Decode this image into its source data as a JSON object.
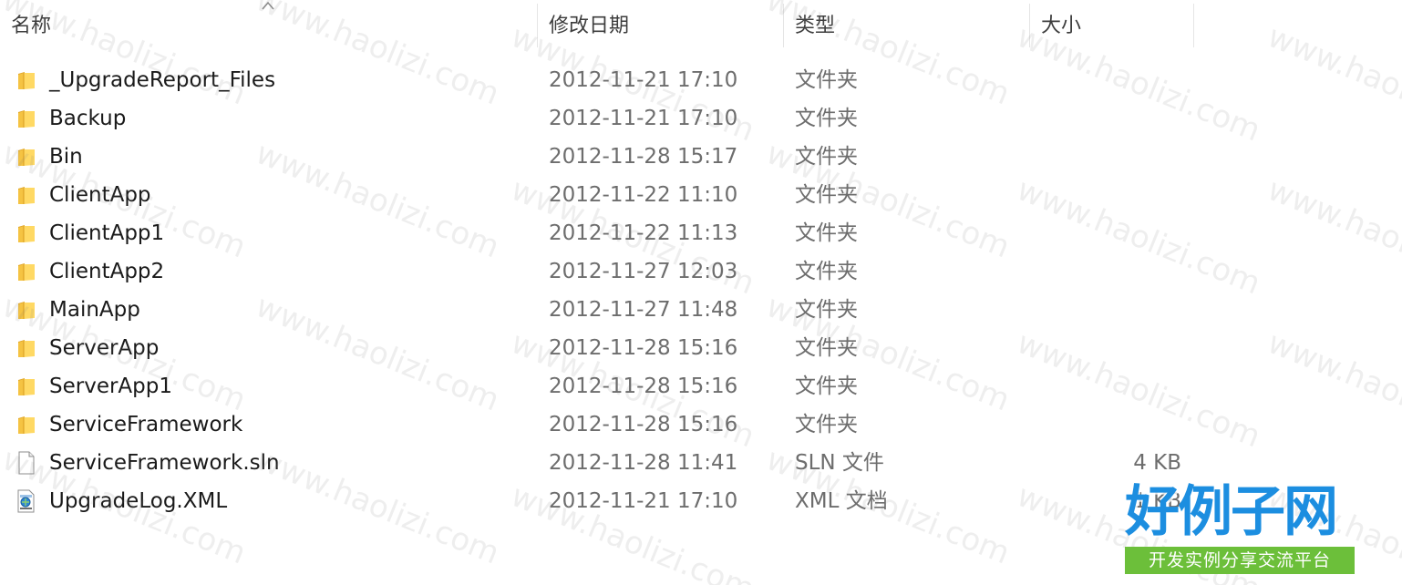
{
  "columns": {
    "name": "名称",
    "date": "修改日期",
    "type": "类型",
    "size": "大小"
  },
  "sort": {
    "column": "name",
    "direction": "ascending"
  },
  "files": [
    {
      "name": "_UpgradeReport_Files",
      "date": "2012-11-21 17:10",
      "type": "文件夹",
      "size": "",
      "icon": "folder-icon"
    },
    {
      "name": "Backup",
      "date": "2012-11-21 17:10",
      "type": "文件夹",
      "size": "",
      "icon": "folder-icon"
    },
    {
      "name": "Bin",
      "date": "2012-11-28 15:17",
      "type": "文件夹",
      "size": "",
      "icon": "folder-icon"
    },
    {
      "name": "ClientApp",
      "date": "2012-11-22 11:10",
      "type": "文件夹",
      "size": "",
      "icon": "folder-icon"
    },
    {
      "name": "ClientApp1",
      "date": "2012-11-22 11:13",
      "type": "文件夹",
      "size": "",
      "icon": "folder-icon"
    },
    {
      "name": "ClientApp2",
      "date": "2012-11-27 12:03",
      "type": "文件夹",
      "size": "",
      "icon": "folder-icon"
    },
    {
      "name": "MainApp",
      "date": "2012-11-27 11:48",
      "type": "文件夹",
      "size": "",
      "icon": "folder-icon"
    },
    {
      "name": "ServerApp",
      "date": "2012-11-28 15:16",
      "type": "文件夹",
      "size": "",
      "icon": "folder-icon"
    },
    {
      "name": "ServerApp1",
      "date": "2012-11-28 15:16",
      "type": "文件夹",
      "size": "",
      "icon": "folder-icon"
    },
    {
      "name": "ServiceFramework",
      "date": "2012-11-28 15:16",
      "type": "文件夹",
      "size": "",
      "icon": "folder-icon"
    },
    {
      "name": "ServiceFramework.sln",
      "date": "2012-11-28 11:41",
      "type": "SLN 文件",
      "size": "4 KB",
      "icon": "sln-file-icon"
    },
    {
      "name": "UpgradeLog.XML",
      "date": "2012-11-21 17:10",
      "type": "XML 文档",
      "size": "1 KB",
      "icon": "xml-file-icon"
    }
  ],
  "watermark": {
    "text": "www.haolizi.com"
  },
  "logo": {
    "main": "好例子网",
    "tagline": "开发实例分享交流平台"
  },
  "colors": {
    "folder": "#f5c342",
    "logo_blue": "#1c8ee0",
    "logo_green": "#6cbf3a"
  }
}
